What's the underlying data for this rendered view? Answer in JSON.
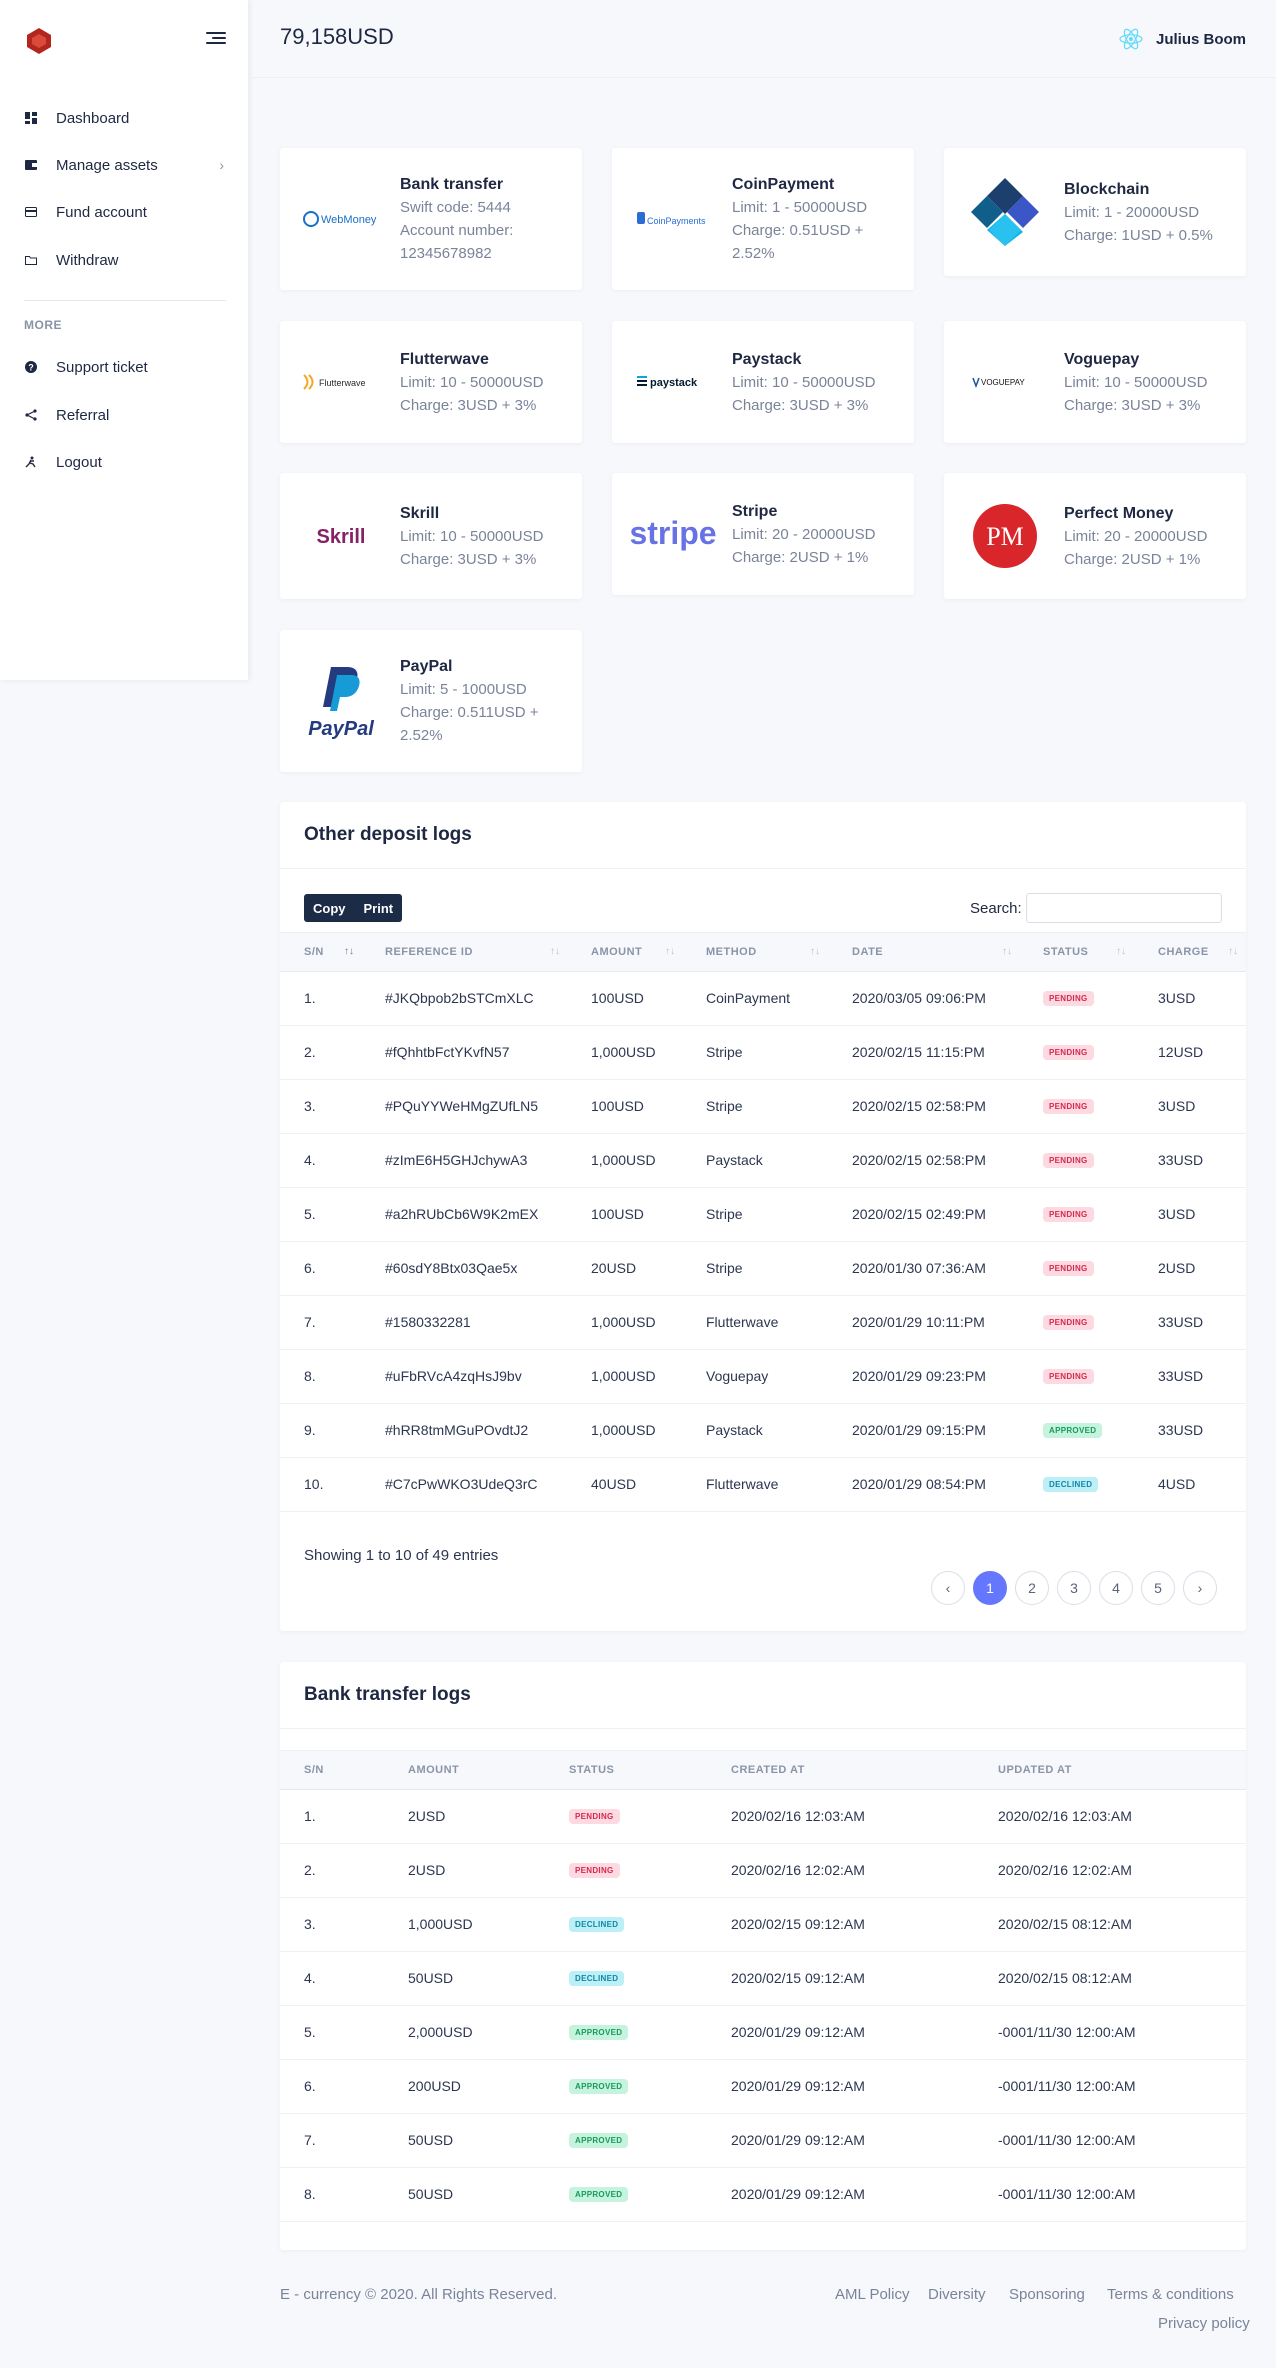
{
  "topbar": {
    "balance": "79,158USD",
    "user_name": "Julius Boom"
  },
  "sidebar": {
    "items": [
      {
        "label": "Dashboard"
      },
      {
        "label": "Manage assets"
      },
      {
        "label": "Fund account"
      },
      {
        "label": "Withdraw"
      }
    ],
    "more_title": "MORE",
    "more_items": [
      {
        "label": "Support ticket"
      },
      {
        "label": "Referral"
      },
      {
        "label": "Logout"
      }
    ]
  },
  "methods": [
    {
      "name": "Bank transfer",
      "lines": [
        "Swift code: 5444",
        "Account number:",
        "12345678982"
      ],
      "logo_text": "WebMoney"
    },
    {
      "name": "CoinPayment",
      "lines": [
        "Limit: 1 - 50000USD",
        "Charge: 0.51USD +",
        "2.52%"
      ],
      "logo_text": "CoinPayments"
    },
    {
      "name": "Blockchain",
      "lines": [
        "Limit: 1 - 20000USD",
        "Charge: 1USD + 0.5%"
      ]
    },
    {
      "name": "Flutterwave",
      "lines": [
        "Limit: 10 - 50000USD",
        "Charge: 3USD + 3%"
      ],
      "logo_text": "Flutterwave"
    },
    {
      "name": "Paystack",
      "lines": [
        "Limit: 10 - 50000USD",
        "Charge: 3USD + 3%"
      ],
      "logo_text": "paystack"
    },
    {
      "name": "Voguepay",
      "lines": [
        "Limit: 10 - 50000USD",
        "Charge: 3USD + 3%"
      ],
      "logo_text": "VOGUEPAY"
    },
    {
      "name": "Skrill",
      "lines": [
        "Limit: 10 - 50000USD",
        "Charge: 3USD + 3%"
      ],
      "logo_text": "Skrill"
    },
    {
      "name": "Stripe",
      "lines": [
        "Limit: 20 - 20000USD",
        "Charge: 2USD + 1%"
      ],
      "logo_text": "stripe"
    },
    {
      "name": "Perfect Money",
      "lines": [
        "Limit: 20 - 20000USD",
        "Charge: 2USD + 1%"
      ],
      "logo_text": "PM"
    },
    {
      "name": "PayPal",
      "lines": [
        "Limit: 5 - 1000USD",
        "Charge: 0.511USD +",
        "2.52%"
      ],
      "logo_text": "PayPal"
    }
  ],
  "deposit_logs": {
    "title": "Other deposit logs",
    "buttons": [
      "Copy",
      "Print"
    ],
    "search_label": "Search:",
    "headers": [
      "S/N",
      "REFERENCE ID",
      "AMOUNT",
      "METHOD",
      "DATE",
      "STATUS",
      "CHARGE"
    ],
    "rows": [
      [
        "1.",
        "#JKQbpob2bSTCmXLC",
        "100USD",
        "CoinPayment",
        "2020/03/05 09:06:PM",
        "PENDING",
        "3USD"
      ],
      [
        "2.",
        "#fQhhtbFctYKvfN57",
        "1,000USD",
        "Stripe",
        "2020/02/15 11:15:PM",
        "PENDING",
        "12USD"
      ],
      [
        "3.",
        "#PQuYYWeHMgZUfLN5",
        "100USD",
        "Stripe",
        "2020/02/15 02:58:PM",
        "PENDING",
        "3USD"
      ],
      [
        "4.",
        "#zImE6H5GHJchywA3",
        "1,000USD",
        "Paystack",
        "2020/02/15 02:58:PM",
        "PENDING",
        "33USD"
      ],
      [
        "5.",
        "#a2hRUbCb6W9K2mEX",
        "100USD",
        "Stripe",
        "2020/02/15 02:49:PM",
        "PENDING",
        "3USD"
      ],
      [
        "6.",
        "#60sdY8Btx03Qae5x",
        "20USD",
        "Stripe",
        "2020/01/30 07:36:AM",
        "PENDING",
        "2USD"
      ],
      [
        "7.",
        "#1580332281",
        "1,000USD",
        "Flutterwave",
        "2020/01/29 10:11:PM",
        "PENDING",
        "33USD"
      ],
      [
        "8.",
        "#uFbRVcA4zqHsJ9bv",
        "1,000USD",
        "Voguepay",
        "2020/01/29 09:23:PM",
        "PENDING",
        "33USD"
      ],
      [
        "9.",
        "#hRR8tmMGuPOvdtJ2",
        "1,000USD",
        "Paystack",
        "2020/01/29 09:15:PM",
        "APPROVED",
        "33USD"
      ],
      [
        "10.",
        "#C7cPwWKO3UdeQ3rC",
        "40USD",
        "Flutterwave",
        "2020/01/29 08:54:PM",
        "DECLINED",
        "4USD"
      ]
    ],
    "showing": "Showing 1 to 10 of 49 entries",
    "pages": [
      "1",
      "2",
      "3",
      "4",
      "5"
    ]
  },
  "bank_logs": {
    "title": "Bank transfer logs",
    "headers": [
      "S/N",
      "AMOUNT",
      "STATUS",
      "CREATED AT",
      "UPDATED AT"
    ],
    "rows": [
      [
        "1.",
        "2USD",
        "PENDING",
        "2020/02/16 12:03:AM",
        "2020/02/16 12:03:AM"
      ],
      [
        "2.",
        "2USD",
        "PENDING",
        "2020/02/16 12:02:AM",
        "2020/02/16 12:02:AM"
      ],
      [
        "3.",
        "1,000USD",
        "DECLINED",
        "2020/02/15 09:12:AM",
        "2020/02/15 08:12:AM"
      ],
      [
        "4.",
        "50USD",
        "DECLINED",
        "2020/02/15 09:12:AM",
        "2020/02/15 08:12:AM"
      ],
      [
        "5.",
        "2,000USD",
        "APPROVED",
        "2020/01/29 09:12:AM",
        "-0001/11/30 12:00:AM"
      ],
      [
        "6.",
        "200USD",
        "APPROVED",
        "2020/01/29 09:12:AM",
        "-0001/11/30 12:00:AM"
      ],
      [
        "7.",
        "50USD",
        "APPROVED",
        "2020/01/29 09:12:AM",
        "-0001/11/30 12:00:AM"
      ],
      [
        "8.",
        "50USD",
        "APPROVED",
        "2020/01/29 09:12:AM",
        "-0001/11/30 12:00:AM"
      ]
    ]
  },
  "footer": {
    "copyright": "E - currency © 2020. All Rights Reserved.",
    "links": [
      "AML Policy",
      "Diversity",
      "Sponsoring",
      "Terms & conditions",
      "Privacy policy"
    ]
  },
  "colors": {
    "accent": "#6576ff",
    "navy": "#1c2b46",
    "pending": "#d6294d",
    "approved": "#199a5b",
    "declined": "#1087a6"
  }
}
